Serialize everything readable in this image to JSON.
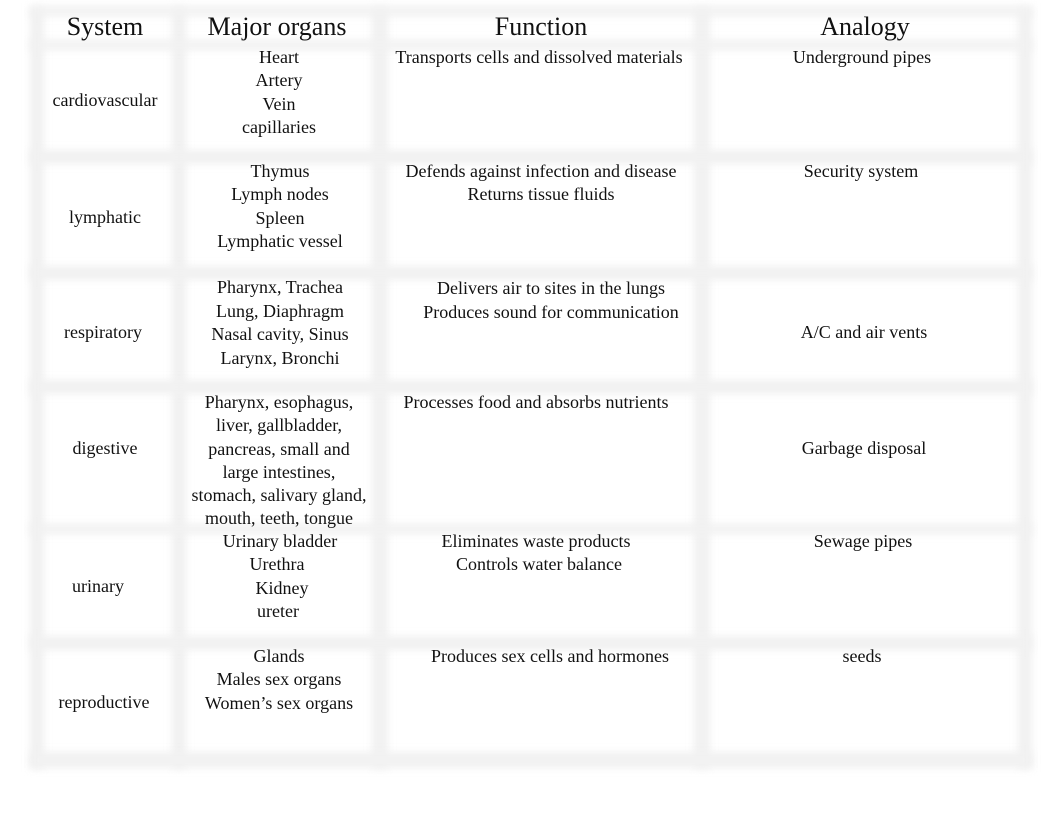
{
  "table": {
    "headers": [
      "System",
      "Major organs",
      "Function",
      "Analogy"
    ],
    "rows": [
      {
        "system": "cardiovascular",
        "organs": [
          "Heart",
          "Artery",
          "Vein",
          "capillaries"
        ],
        "function": [
          "Transports cells and dissolved materials"
        ],
        "analogy": "Underground pipes"
      },
      {
        "system": "lymphatic",
        "organs": [
          "Thymus",
          "Lymph nodes",
          "Spleen",
          "Lymphatic vessel"
        ],
        "function": [
          "Defends against infection and disease",
          "Returns tissue fluids"
        ],
        "analogy": "Security system"
      },
      {
        "system": "respiratory",
        "organs": [
          "Pharynx, Trachea",
          "Lung, Diaphragm",
          "Nasal cavity, Sinus",
          "Larynx, Bronchi"
        ],
        "function": [
          "Delivers air to sites in the lungs",
          "Produces sound for communication"
        ],
        "analogy": "A/C and air vents"
      },
      {
        "system": "digestive",
        "organs": [
          "Pharynx, esophagus,",
          "liver, gallbladder,",
          "pancreas, small and",
          "large intestines,",
          "stomach, salivary gland,",
          "mouth, teeth, tongue"
        ],
        "function": [
          "Processes food and absorbs nutrients"
        ],
        "analogy": "Garbage disposal"
      },
      {
        "system": "urinary",
        "organs": [
          "Urinary bladder",
          "Urethra",
          "Kidney",
          "ureter"
        ],
        "function": [
          "Eliminates waste products",
          "Controls water balance"
        ],
        "analogy": "Sewage pipes"
      },
      {
        "system": "reproductive",
        "organs": [
          "Glands",
          "Males sex organs",
          "Women’s sex organs"
        ],
        "function": [
          "Produces sex cells and hormones"
        ],
        "analogy": "seeds"
      }
    ]
  }
}
